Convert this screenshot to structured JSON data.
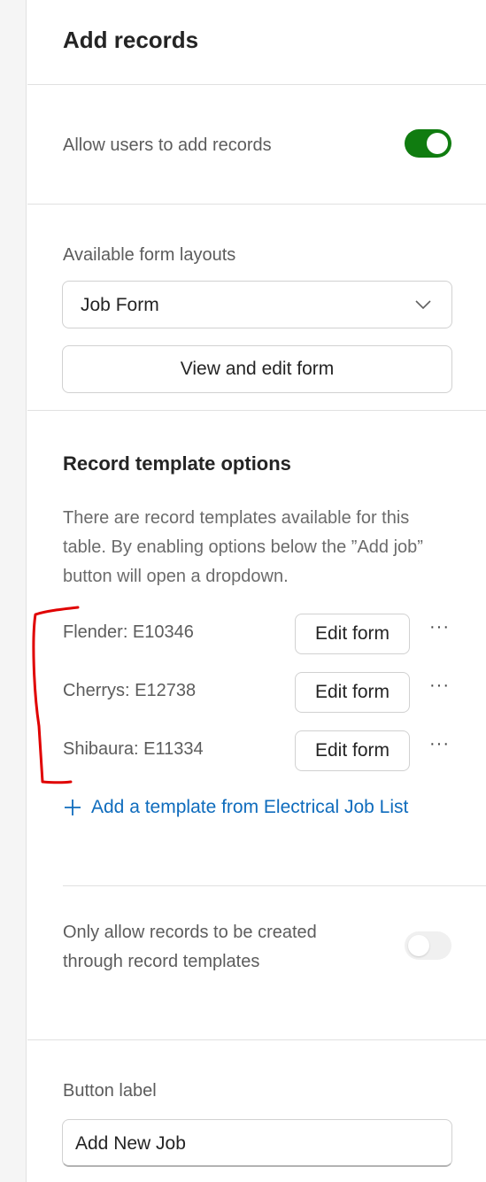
{
  "panel": {
    "title": "Add records"
  },
  "allow_add": {
    "label": "Allow users to add records",
    "enabled": true
  },
  "form_layouts": {
    "label": "Available form layouts",
    "selected": "Job Form",
    "view_edit_label": "View and edit form"
  },
  "templates": {
    "title": "Record template options",
    "description": "There are record templates available for this table. By enabling options below the ”Add job” button will open a dropdown.",
    "items": [
      {
        "name": "Flender: E10346",
        "edit_label": "Edit form",
        "more": "···"
      },
      {
        "name": "Cherrys: E12738",
        "edit_label": "Edit form",
        "more": "···"
      },
      {
        "name": "Shibaura: E11334",
        "edit_label": "Edit form",
        "more": "···"
      }
    ],
    "add_link": "Add a template from Electrical Job List"
  },
  "only_templates": {
    "label_line1": "Only allow records to be created",
    "label_line2": "through record templates",
    "enabled": false
  },
  "button_label": {
    "label": "Button label",
    "value": "Add New Job"
  },
  "colors": {
    "accent": "#107c10",
    "link": "#0f6cbd",
    "annotation": "#e00000"
  }
}
